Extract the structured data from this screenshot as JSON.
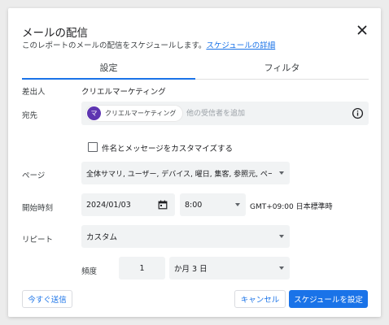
{
  "dialog": {
    "title": "メールの配信",
    "subtitle": "このレポートのメールの配信をスケジュールします。",
    "subtitle_link": "スケジュールの詳細"
  },
  "tabs": [
    {
      "label": "設定",
      "active": true
    },
    {
      "label": "フィルタ",
      "active": false
    }
  ],
  "form": {
    "sender": {
      "label": "差出人",
      "value": "クリエルマーケティング"
    },
    "recipients": {
      "label": "宛先",
      "chip_avatar": "マ",
      "chip_label": "クリエルマーケティング",
      "placeholder": "他の受信者を追加"
    },
    "customize": {
      "label": "件名とメッセージをカスタマイズする",
      "checked": false
    },
    "pages": {
      "label": "ページ",
      "value": "全体サマリ, ユーザー, デバイス, 曜日, 集客, 参照元, ページ, ..."
    },
    "start": {
      "label": "開始時刻",
      "date": "2024/01/03",
      "time": "8:00",
      "timezone": "GMT+09:00 日本標準時"
    },
    "repeat": {
      "label": "リピート",
      "value": "カスタム"
    },
    "frequency": {
      "label": "頻度",
      "count": "1",
      "unit": "か月 3 日"
    }
  },
  "footer": {
    "send_now": "今すぐ送信",
    "cancel": "キャンセル",
    "schedule": "スケジュールを設定"
  },
  "colors": {
    "accent": "#1a73e8",
    "avatar": "#5e35b1",
    "field_bg": "#f1f3f4"
  }
}
